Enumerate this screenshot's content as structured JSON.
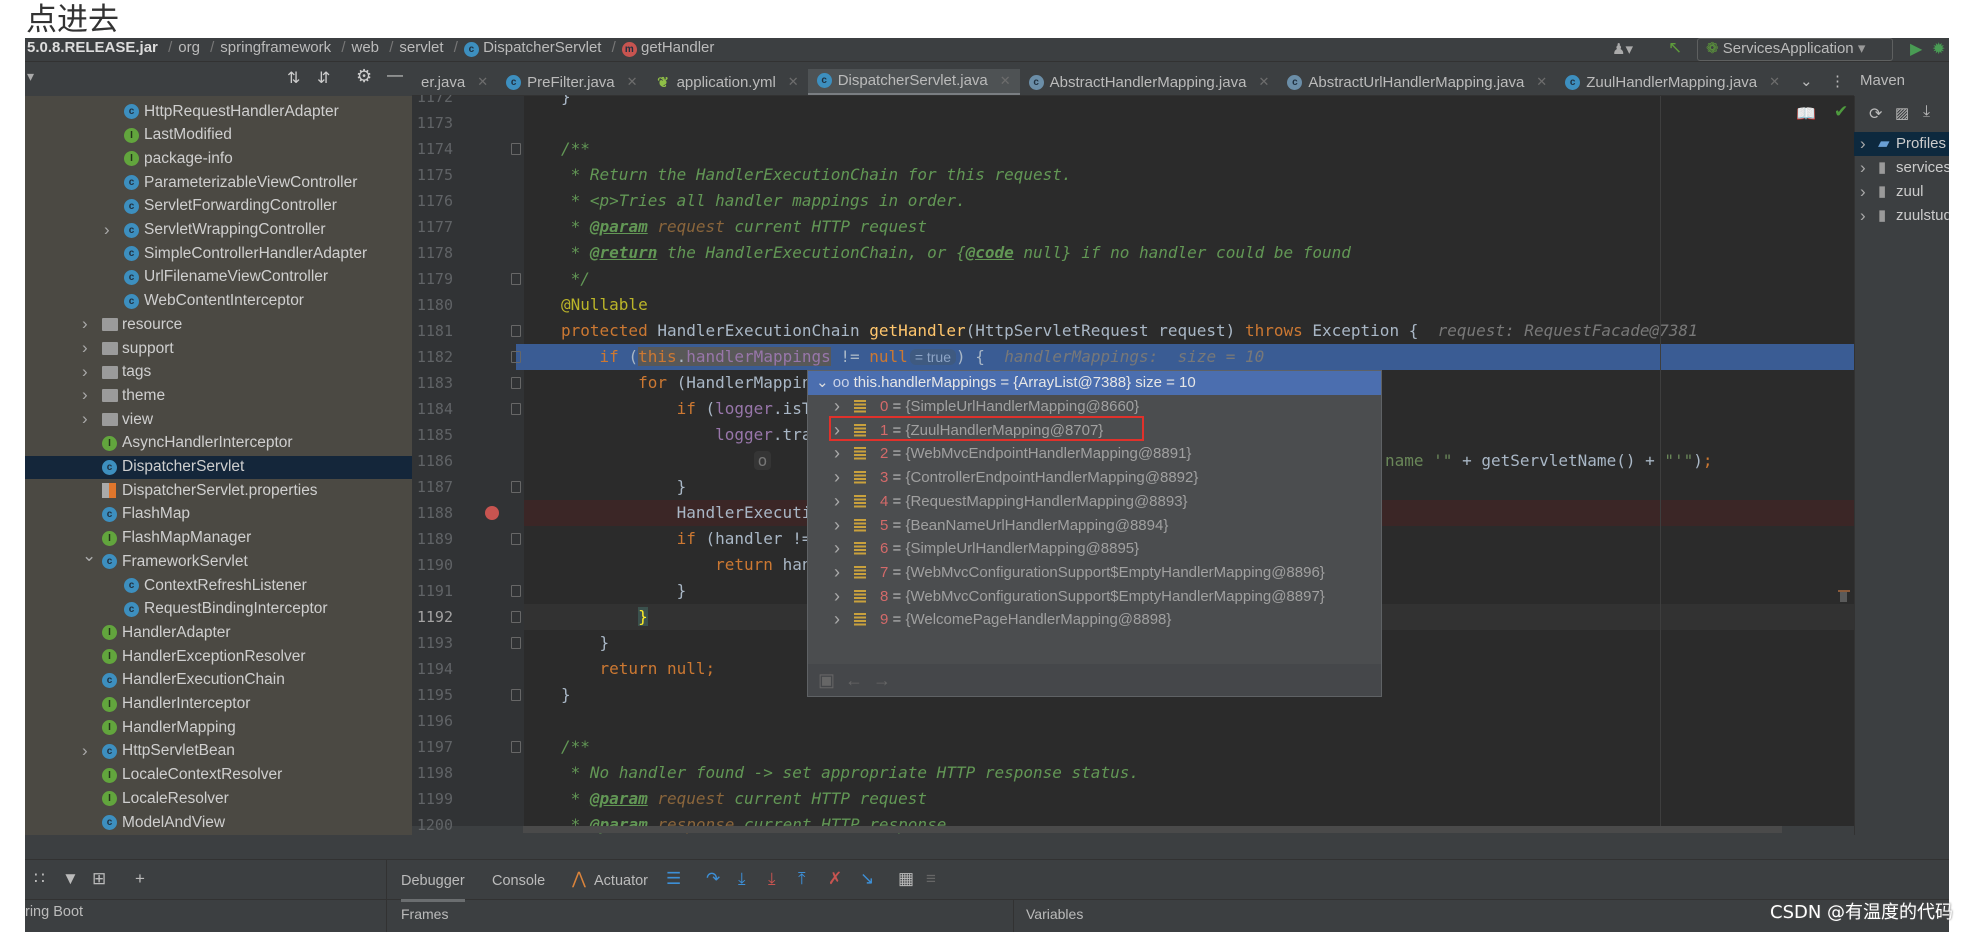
{
  "caption": "点进去",
  "breadcrumb": {
    "jar": "5.0.8.RELEASE.jar",
    "parts": [
      "org",
      "springframework",
      "web",
      "servlet",
      "DispatcherServlet",
      "getHandler"
    ]
  },
  "run_config": "ServicesApplication",
  "tabs": [
    {
      "label": "er.java",
      "icon": "none"
    },
    {
      "label": "PreFilter.java",
      "icon": "class"
    },
    {
      "label": "application.yml",
      "icon": "yaml"
    },
    {
      "label": "DispatcherServlet.java",
      "icon": "class",
      "active": true
    },
    {
      "label": "AbstractHandlerMapping.java",
      "icon": "abstract-class"
    },
    {
      "label": "AbstractUrlHandlerMapping.java",
      "icon": "abstract-class"
    },
    {
      "label": "ZuulHandlerMapping.java",
      "icon": "class"
    }
  ],
  "maven": {
    "title": "Maven",
    "items": [
      "Profiles",
      "services",
      "zuul",
      "zuulstudy"
    ]
  },
  "tree": [
    {
      "label": "HttpRequestHandlerAdapter",
      "type": "c",
      "level": 2
    },
    {
      "label": "LastModified",
      "type": "i",
      "level": 2
    },
    {
      "label": "package-info",
      "type": "i",
      "level": 2
    },
    {
      "label": "ParameterizableViewController",
      "type": "c",
      "level": 2
    },
    {
      "label": "ServletForwardingController",
      "type": "c",
      "level": 2
    },
    {
      "label": "ServletWrappingController",
      "type": "c",
      "level": 2,
      "arrow": "collapsed"
    },
    {
      "label": "SimpleControllerHandlerAdapter",
      "type": "c",
      "level": 2
    },
    {
      "label": "UrlFilenameViewController",
      "type": "c",
      "level": 2
    },
    {
      "label": "WebContentInterceptor",
      "type": "c",
      "level": 2
    },
    {
      "label": "resource",
      "type": "folder",
      "level": 1,
      "arrow": "collapsed"
    },
    {
      "label": "support",
      "type": "folder",
      "level": 1,
      "arrow": "collapsed"
    },
    {
      "label": "tags",
      "type": "folder",
      "level": 1,
      "arrow": "collapsed"
    },
    {
      "label": "theme",
      "type": "folder",
      "level": 1,
      "arrow": "collapsed"
    },
    {
      "label": "view",
      "type": "folder",
      "level": 1,
      "arrow": "collapsed"
    },
    {
      "label": "AsyncHandlerInterceptor",
      "type": "i",
      "level": 1
    },
    {
      "label": "DispatcherServlet",
      "type": "c",
      "level": 1,
      "selected": true
    },
    {
      "label": "DispatcherServlet.properties",
      "type": "props",
      "level": 1
    },
    {
      "label": "FlashMap",
      "type": "c",
      "level": 1
    },
    {
      "label": "FlashMapManager",
      "type": "i",
      "level": 1
    },
    {
      "label": "FrameworkServlet",
      "type": "c",
      "level": 1,
      "arrow": "expanded"
    },
    {
      "label": "ContextRefreshListener",
      "type": "c",
      "level": 2
    },
    {
      "label": "RequestBindingInterceptor",
      "type": "c",
      "level": 2
    },
    {
      "label": "HandlerAdapter",
      "type": "i",
      "level": 1
    },
    {
      "label": "HandlerExceptionResolver",
      "type": "i",
      "level": 1
    },
    {
      "label": "HandlerExecutionChain",
      "type": "c",
      "level": 1
    },
    {
      "label": "HandlerInterceptor",
      "type": "i",
      "level": 1
    },
    {
      "label": "HandlerMapping",
      "type": "i",
      "level": 1
    },
    {
      "label": "HttpServletBean",
      "type": "c",
      "level": 1,
      "arrow": "collapsed"
    },
    {
      "label": "LocaleContextResolver",
      "type": "i",
      "level": 1
    },
    {
      "label": "LocaleResolver",
      "type": "i",
      "level": 1
    },
    {
      "label": "ModelAndView",
      "type": "c",
      "level": 1
    }
  ],
  "editor": {
    "current_line": 1192,
    "execution_line": 1182,
    "breakpoint_line": 1188,
    "lines": [
      {
        "n": 1172,
        "tokens": [
          [
            "}",
            "t"
          ]
        ]
      },
      {
        "n": 1173,
        "tokens": []
      },
      {
        "n": 1174,
        "tokens": [
          [
            "/**",
            "c"
          ]
        ],
        "fold": true
      },
      {
        "n": 1175,
        "tokens": [
          [
            " * Return the HandlerExecutionChain for this request.",
            "c"
          ]
        ]
      },
      {
        "n": 1176,
        "tokens": [
          [
            " * <p>Tries all handler mappings in order.",
            "c"
          ]
        ]
      },
      {
        "n": 1177,
        "tokens": [
          [
            " * ",
            "c"
          ],
          [
            "@param",
            "ct"
          ],
          [
            " request",
            "cp"
          ],
          [
            " current HTTP request",
            "c"
          ]
        ]
      },
      {
        "n": 1178,
        "tokens": [
          [
            " * ",
            "c"
          ],
          [
            "@return",
            "ct"
          ],
          [
            " the HandlerExecutionChain, or {",
            "c"
          ],
          [
            "@code",
            "ct"
          ],
          [
            " null} if no handler could be found",
            "c"
          ]
        ]
      },
      {
        "n": 1179,
        "tokens": [
          [
            " */",
            "c"
          ]
        ],
        "fold": true
      },
      {
        "n": 1180,
        "tokens": [
          [
            "@Nullable",
            "a"
          ]
        ]
      },
      {
        "n": 1181,
        "tokens": [
          [
            "protected ",
            "k"
          ],
          [
            "HandlerExecutionChain ",
            "t"
          ],
          [
            "getHandler",
            "m"
          ],
          [
            "(HttpServletRequest request) ",
            "t"
          ],
          [
            "throws ",
            "k"
          ],
          [
            "Exception {",
            "t"
          ],
          [
            "  request: RequestFacade@7381",
            "h"
          ]
        ],
        "fold": true
      },
      {
        "n": 1182,
        "tokens": [
          [
            "    ",
            "t"
          ],
          [
            "if ",
            "k"
          ],
          [
            "(",
            "t"
          ],
          [
            "this",
            "k sel"
          ],
          [
            ".",
            "t sel"
          ],
          [
            "handlerMappings",
            "f sel"
          ],
          [
            " != ",
            "t"
          ],
          [
            "null",
            "k"
          ],
          [
            "= true",
            "pill"
          ],
          [
            ") {",
            "t"
          ],
          [
            "  handlerMappings:  size = 10",
            "h"
          ]
        ],
        "fold": true
      },
      {
        "n": 1183,
        "tokens": [
          [
            "        ",
            "t"
          ],
          [
            "for ",
            "k"
          ],
          [
            "(HandlerMappin",
            "t"
          ]
        ],
        "fold": true
      },
      {
        "n": 1184,
        "tokens": [
          [
            "            ",
            "t"
          ],
          [
            "if ",
            "k"
          ],
          [
            "(",
            "t"
          ],
          [
            "logger",
            "f"
          ],
          [
            ".isT",
            "t"
          ]
        ],
        "fold": true
      },
      {
        "n": 1185,
        "tokens": [
          [
            "                ",
            "t"
          ],
          [
            "logger",
            "f"
          ],
          [
            ".tra",
            "t"
          ]
        ]
      },
      {
        "n": 1186,
        "tokens": [
          [
            "                    ",
            "t"
          ],
          [
            "o",
            "pill2"
          ]
        ],
        "right": [
          [
            "name '\"",
            "s"
          ],
          [
            " + getServletName() + ",
            "t"
          ],
          [
            "\"'\"",
            "s"
          ],
          [
            ")",
            "t"
          ],
          [
            ";",
            "k"
          ]
        ]
      },
      {
        "n": 1187,
        "tokens": [
          [
            "            }",
            "t"
          ]
        ],
        "fold": true
      },
      {
        "n": 1188,
        "tokens": [
          [
            "            HandlerExecuti",
            "t"
          ]
        ]
      },
      {
        "n": 1189,
        "tokens": [
          [
            "            ",
            "t"
          ],
          [
            "if ",
            "k"
          ],
          [
            "(handler !=",
            "t"
          ]
        ],
        "fold": true
      },
      {
        "n": 1190,
        "tokens": [
          [
            "                ",
            "t"
          ],
          [
            "return ",
            "k"
          ],
          [
            "han",
            "t"
          ]
        ]
      },
      {
        "n": 1191,
        "tokens": [
          [
            "            }",
            "t"
          ]
        ],
        "fold": true
      },
      {
        "n": 1192,
        "tokens": [
          [
            "        ",
            "t"
          ],
          [
            "}",
            "yb"
          ]
        ],
        "fold": true
      },
      {
        "n": 1193,
        "tokens": [
          [
            "    }",
            "t"
          ]
        ],
        "fold": true
      },
      {
        "n": 1194,
        "tokens": [
          [
            "    ",
            "t"
          ],
          [
            "return null;",
            "k"
          ]
        ]
      },
      {
        "n": 1195,
        "tokens": [
          [
            "}",
            "t"
          ]
        ],
        "fold": true
      },
      {
        "n": 1196,
        "tokens": []
      },
      {
        "n": 1197,
        "tokens": [
          [
            "/**",
            "c"
          ]
        ],
        "fold": true
      },
      {
        "n": 1198,
        "tokens": [
          [
            " * No handler found -> set appropriate HTTP response status.",
            "c"
          ]
        ]
      },
      {
        "n": 1199,
        "tokens": [
          [
            " * ",
            "c"
          ],
          [
            "@param",
            "ct"
          ],
          [
            " request",
            "cp"
          ],
          [
            " current HTTP request",
            "c"
          ]
        ]
      },
      {
        "n": 1200,
        "tokens": [
          [
            " * ",
            "c"
          ],
          [
            "@param",
            "ct"
          ],
          [
            " response",
            "cp"
          ],
          [
            " current HTTP response",
            "c"
          ]
        ]
      }
    ]
  },
  "popup": {
    "header": "this.handlerMappings = {ArrayList@7388}  size = 10",
    "items": [
      {
        "index": "0",
        "value": "{SimpleUrlHandlerMapping@8660}"
      },
      {
        "index": "1",
        "value": "{ZuulHandlerMapping@8707}",
        "highlighted": true
      },
      {
        "index": "2",
        "value": "{WebMvcEndpointHandlerMapping@8891}"
      },
      {
        "index": "3",
        "value": "{ControllerEndpointHandlerMapping@8892}"
      },
      {
        "index": "4",
        "value": "{RequestMappingHandlerMapping@8893}"
      },
      {
        "index": "5",
        "value": "{BeanNameUrlHandlerMapping@8894}"
      },
      {
        "index": "6",
        "value": "{SimpleUrlHandlerMapping@8895}"
      },
      {
        "index": "7",
        "value": "{WebMvcConfigurationSupport$EmptyHandlerMapping@8896}"
      },
      {
        "index": "8",
        "value": "{WebMvcConfigurationSupport$EmptyHandlerMapping@8897}"
      },
      {
        "index": "9",
        "value": "{WelcomePageHandlerMapping@8898}"
      }
    ]
  },
  "debug": {
    "tabs": [
      "Debugger",
      "Console",
      "Actuator"
    ],
    "services_label": "ring Boot",
    "frames_label": "Frames",
    "variables_label": "Variables"
  },
  "watermark": "CSDN @有温度的代码"
}
